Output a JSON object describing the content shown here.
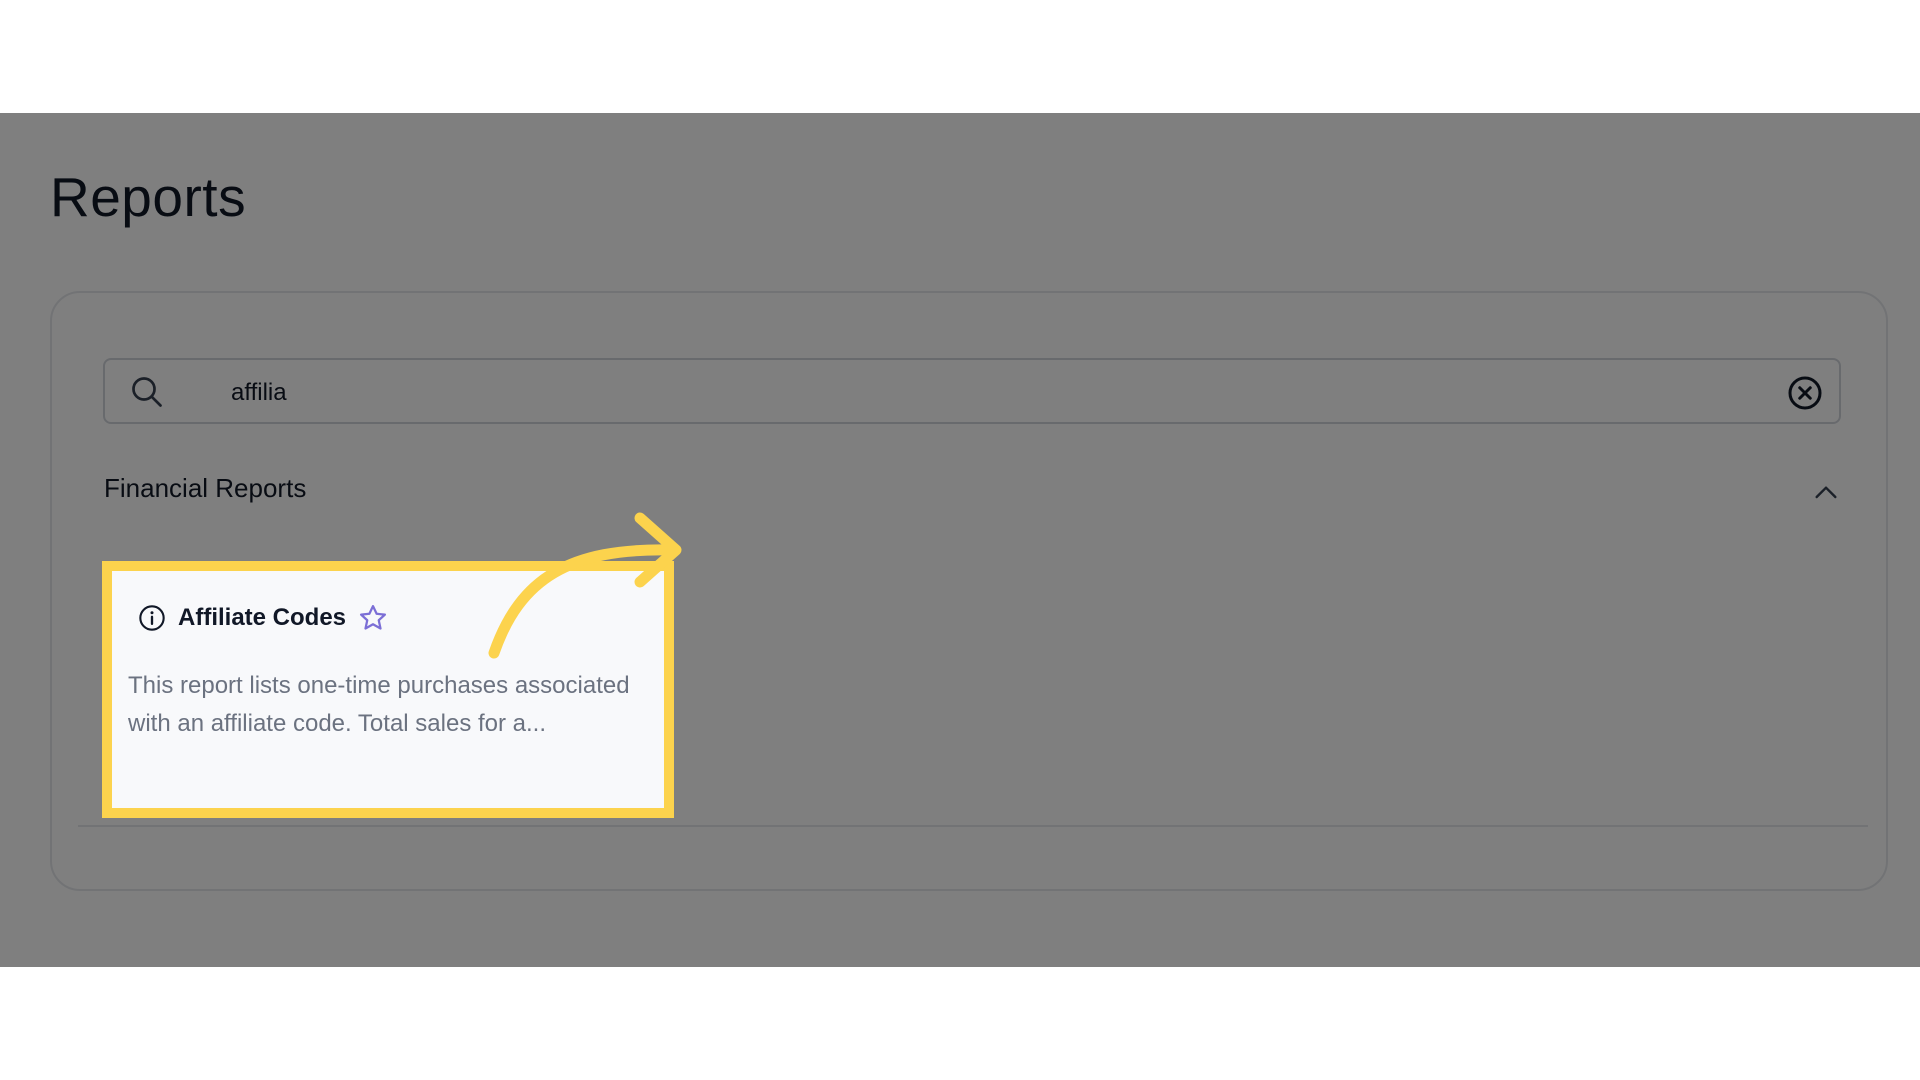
{
  "page": {
    "title": "Reports"
  },
  "search": {
    "value": "affilia"
  },
  "section": {
    "title": "Financial Reports"
  },
  "report_card": {
    "title": "Affiliate Codes",
    "description": "This report lists one-time purchases associated with an affiliate code. Total sales for a..."
  },
  "icons": {
    "search": "search-icon",
    "clear": "clear-circle-x-icon",
    "collapse": "chevron-up-icon",
    "info": "info-icon",
    "favorite": "star-icon",
    "annotation": "curved-arrow-icon"
  },
  "colors": {
    "overlay": "#808080",
    "highlight": "#fcd34d",
    "star": "#7c6fd6",
    "text": "#111827",
    "muted": "#6b7280"
  }
}
